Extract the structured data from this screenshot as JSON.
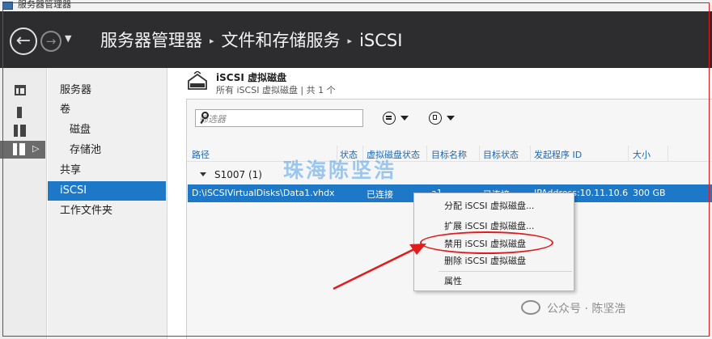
{
  "window": {
    "title": "服务器管理器"
  },
  "header": {
    "back_icon": "back-arrow",
    "forward_icon": "forward-arrow",
    "breadcrumb": [
      "服务器管理器",
      "文件和存储服务",
      "iSCSI"
    ],
    "separator": "▸"
  },
  "iconbar": {
    "items": [
      "dashboard-icon",
      "local-server-icon",
      "all-servers-icon",
      "file-storage-icon"
    ],
    "active_arrow": "▷"
  },
  "sidebar": {
    "items": [
      {
        "label": "服务器",
        "level": 1
      },
      {
        "label": "卷",
        "level": 1
      },
      {
        "label": "磁盘",
        "level": 2
      },
      {
        "label": "存储池",
        "level": 2
      },
      {
        "label": "共享",
        "level": 1
      },
      {
        "label": "iSCSI",
        "level": 1,
        "selected": true
      },
      {
        "label": "工作文件夹",
        "level": 1
      }
    ]
  },
  "tile": {
    "title": "iSCSI 虚拟磁盘",
    "subtitle": "所有 iSCSI 虚拟磁盘 | 共 1 个",
    "filter_placeholder": "筛选器"
  },
  "grid": {
    "columns": [
      "路径",
      "状态",
      "虚拟磁盘状态",
      "目标名称",
      "目标状态",
      "发起程序 ID",
      "大小"
    ],
    "group": "S1007 (1)",
    "rows": [
      {
        "path": "D:\\iSCSIVirtualDisks\\Data1.vhdx",
        "status": "",
        "disk_status": "已连接",
        "target_name": "a1",
        "target_status": "已连接",
        "initiator_id": "IPAddress:10.11.10.6",
        "size": "300 GB"
      }
    ]
  },
  "context_menu": {
    "items": [
      "分配 iSCSI 虚拟磁盘...",
      "扩展 iSCSI 虚拟磁盘...",
      "禁用 iSCSI 虚拟磁盘",
      "删除 iSCSI 虚拟磁盘",
      "属性"
    ]
  },
  "watermarks": {
    "center": "珠海陈坚浩",
    "wechat": "公众号 · 陈坚浩"
  },
  "colors": {
    "selection": "#1e78c8",
    "header": "#2d2d30",
    "annotation": "#e01c1c"
  }
}
